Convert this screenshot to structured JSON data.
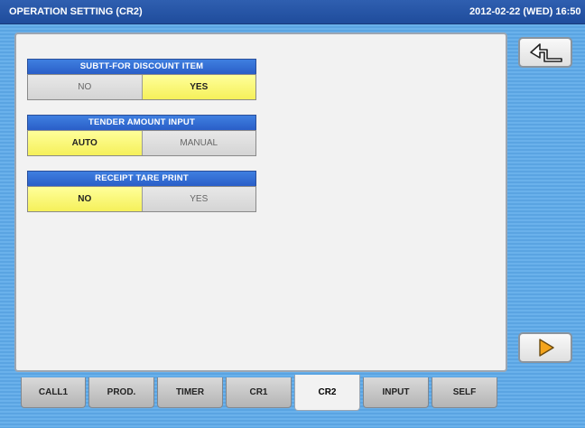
{
  "title": "OPERATION SETTING (CR2)",
  "datetime": "2012-02-22 (WED) 16:50",
  "groups": [
    {
      "label": "SUBTT-FOR DISCOUNT ITEM",
      "options": [
        "NO",
        "YES"
      ],
      "selected": "YES"
    },
    {
      "label": "TENDER AMOUNT INPUT",
      "options": [
        "AUTO",
        "MANUAL"
      ],
      "selected": "AUTO"
    },
    {
      "label": "RECEIPT TARE PRINT",
      "options": [
        "NO",
        "YES"
      ],
      "selected": "NO"
    }
  ],
  "tabs": [
    "CALL1",
    "PROD.",
    "TIMER",
    "CR1",
    "CR2",
    "INPUT",
    "SELF"
  ],
  "active_tab": "CR2",
  "icons": {
    "back": "return-arrow-icon",
    "next": "play-triangle-icon"
  },
  "colors": {
    "selected": "#f5f05a",
    "header": "#2a5ec8",
    "titlebar": "#1f4c9c"
  }
}
